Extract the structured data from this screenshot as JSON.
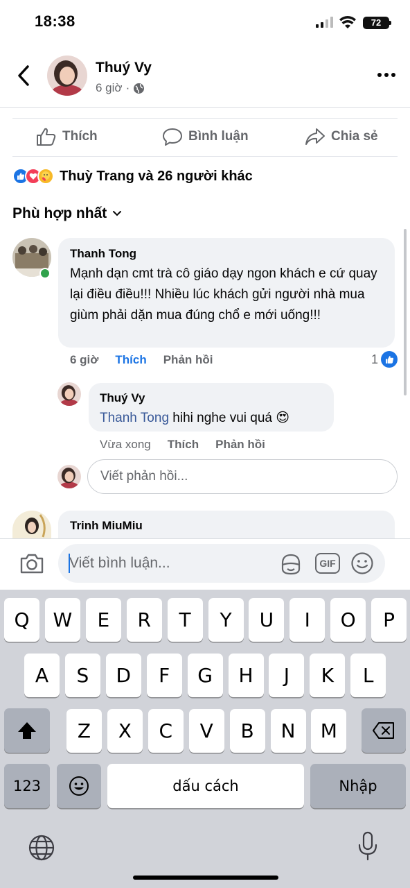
{
  "status_bar": {
    "time": "18:38",
    "battery": "72"
  },
  "header": {
    "name": "Thuý Vy",
    "time": "6 giờ",
    "separator": "·",
    "audience_icon": "globe-icon"
  },
  "post_actions": {
    "like": "Thích",
    "comment": "Bình luận",
    "share": "Chia sẻ"
  },
  "reactions": {
    "text": "Thuỳ Trang và 26 người khác",
    "icons": [
      "like-icon",
      "love-icon",
      "care-icon"
    ]
  },
  "sort": {
    "label": "Phù hợp nhất"
  },
  "comments": [
    {
      "author": "Thanh Tong",
      "text": "Mạnh dạn cmt trà cô giáo dạy ngon khách e cứ quay lại điều điều!!! Nhiều lúc khách gửi người nhà mua giùm phải dặn mua đúng chổ e mới uống!!!",
      "time": "6 giờ",
      "like": "Thích",
      "reply": "Phản hồi",
      "like_count": "1"
    },
    {
      "author": "Thuý Vy",
      "mention": "Thanh Tong",
      "text": "hihi nghe vui quá",
      "emoji": "😍",
      "time": "Vừa xong",
      "like": "Thích",
      "reply": "Phản hồi"
    },
    {
      "author": "Trinh MiuMiu"
    }
  ],
  "reply_input": {
    "placeholder": "Viết phản hồi..."
  },
  "composer": {
    "placeholder": "Viết bình luận...",
    "gif": "GIF"
  },
  "keyboard": {
    "row1": [
      "Q",
      "W",
      "E",
      "R",
      "T",
      "Y",
      "U",
      "I",
      "O",
      "P"
    ],
    "row2": [
      "A",
      "S",
      "D",
      "F",
      "G",
      "H",
      "J",
      "K",
      "L"
    ],
    "row3": [
      "Z",
      "X",
      "C",
      "V",
      "B",
      "N",
      "M"
    ],
    "numbers": "123",
    "space": "dấu cách",
    "return": "Nhập"
  },
  "colors": {
    "accent": "#1b74e4",
    "link": "#385898",
    "bubble": "#f0f2f5",
    "muted": "#65676b"
  }
}
